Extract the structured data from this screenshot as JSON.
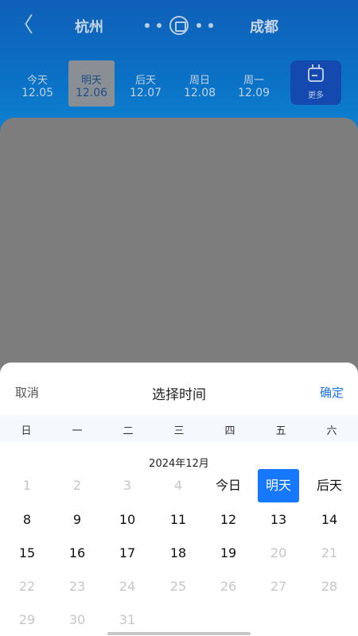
{
  "header": {
    "back_glyph": "〈",
    "from_city": "杭州",
    "to_city": "成都",
    "route_icon": "train-icon"
  },
  "dates": [
    {
      "label": "今天",
      "date": "12.05",
      "selected": false
    },
    {
      "label": "明天",
      "date": "12.06",
      "selected": true
    },
    {
      "label": "后天",
      "date": "12.07",
      "selected": false
    },
    {
      "label": "周日",
      "date": "12.08",
      "selected": false
    },
    {
      "label": "周一",
      "date": "12.09",
      "selected": false
    }
  ],
  "more": {
    "label": "更多",
    "icon": "calendar-icon"
  },
  "sheet": {
    "cancel": "取消",
    "title": "选择时间",
    "confirm": "确定",
    "weekdays": [
      "日",
      "一",
      "二",
      "三",
      "四",
      "五",
      "六"
    ],
    "month": "2024年12月",
    "rows": [
      [
        {
          "t": "1",
          "m": true
        },
        {
          "t": "2",
          "m": true
        },
        {
          "t": "3",
          "m": true
        },
        {
          "t": "4",
          "m": true
        },
        {
          "t": "今日",
          "m": false
        },
        {
          "t": "明天",
          "m": false,
          "sel": true
        },
        {
          "t": "后天",
          "m": false
        }
      ],
      [
        {
          "t": "8"
        },
        {
          "t": "9"
        },
        {
          "t": "10"
        },
        {
          "t": "11"
        },
        {
          "t": "12"
        },
        {
          "t": "13"
        },
        {
          "t": "14"
        }
      ],
      [
        {
          "t": "15"
        },
        {
          "t": "16"
        },
        {
          "t": "17"
        },
        {
          "t": "18"
        },
        {
          "t": "19"
        },
        {
          "t": "20",
          "m": true
        },
        {
          "t": "21",
          "m": true
        }
      ],
      [
        {
          "t": "22",
          "m": true
        },
        {
          "t": "23",
          "m": true
        },
        {
          "t": "24",
          "m": true
        },
        {
          "t": "25",
          "m": true
        },
        {
          "t": "26",
          "m": true
        },
        {
          "t": "27",
          "m": true
        },
        {
          "t": "28",
          "m": true
        }
      ],
      [
        {
          "t": "29",
          "m": true
        },
        {
          "t": "30",
          "m": true
        },
        {
          "t": "31",
          "m": true
        }
      ]
    ]
  },
  "colors": {
    "accent": "#1677ff",
    "header_blue": "#0b72c6",
    "muted_day": "#c6c6c6"
  }
}
